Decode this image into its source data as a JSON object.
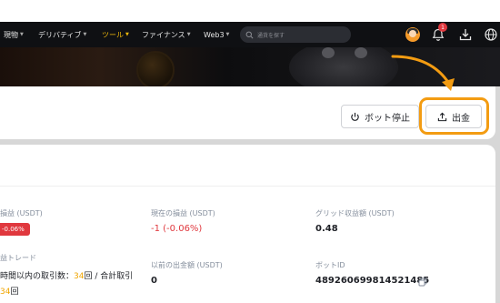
{
  "nav": {
    "items": [
      {
        "label": "現物",
        "active": false
      },
      {
        "label": "デリバティブ",
        "active": false
      },
      {
        "label": "ツール",
        "active": true
      },
      {
        "label": "ファイナンス",
        "active": false
      },
      {
        "label": "Web3",
        "active": false
      }
    ],
    "search_placeholder": "通貨を探す",
    "notification_count": "1",
    "icons": [
      "avatar",
      "bell-icon",
      "download-icon",
      "globe-icon"
    ]
  },
  "actions": {
    "stop_label": "ボット停止",
    "withdraw_label": "出金"
  },
  "stats": {
    "total_pnl_label": "損益 (USDT)",
    "total_pnl_pill": "-0.06%",
    "current_pnl_label": "現在の損益 (USDT)",
    "current_pnl_value": "-1 (-0.06%)",
    "grid_profit_label": "グリッド収益額 (USDT)",
    "grid_profit_value": "0.48",
    "trades_label": "益トレード",
    "trades_text_prefix": "時間以内の取引数：",
    "trades_24h": "34",
    "trades_text_mid": "回 / 合計取引",
    "trades_total": "34",
    "trades_text_suffix": "回",
    "prev_withdraw_label": "以前の出金額 (USDT)",
    "prev_withdraw_value": "0",
    "bot_id_label": "ボットID",
    "bot_id_value": "489260699814521485"
  },
  "colors": {
    "accent": "#f0b90b",
    "highlight": "#f39c12",
    "negative": "#e0383e"
  }
}
